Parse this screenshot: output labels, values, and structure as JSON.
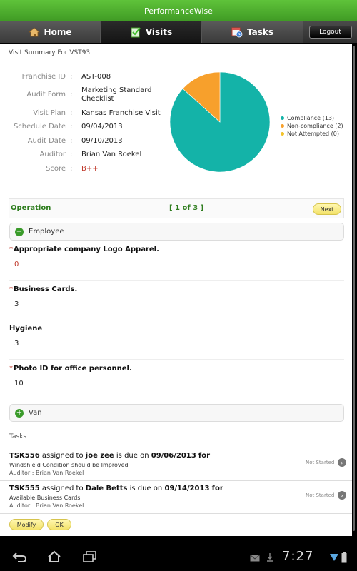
{
  "app": {
    "title": "PerformanceWise"
  },
  "nav": {
    "tabs": [
      {
        "label": "Home",
        "icon": "home-icon"
      },
      {
        "label": "Visits",
        "icon": "checklist-icon"
      },
      {
        "label": "Tasks",
        "icon": "calendar-clock-icon"
      }
    ],
    "active_tab": "Visits",
    "logout_label": "Logout"
  },
  "summary": {
    "title": "Visit Summary For VST93",
    "fields": [
      {
        "label": "Franchise ID",
        "value": "AST-008"
      },
      {
        "label": "Audit Form",
        "value": "Marketing Standard Checklist"
      },
      {
        "label": "Visit Plan",
        "value": "Kansas Franchise Visit"
      },
      {
        "label": "Schedule Date",
        "value": "09/04/2013"
      },
      {
        "label": "Audit Date",
        "value": "09/10/2013"
      },
      {
        "label": "Auditor",
        "value": "Brian Van Roekel"
      },
      {
        "label": "Score",
        "value": "B++"
      }
    ]
  },
  "chart_data": {
    "type": "pie",
    "categories": [
      "Compliance",
      "Non-compliance",
      "Not Attempted"
    ],
    "values": [
      13,
      2,
      0
    ],
    "legend": [
      "Compliance (13)",
      "Non-compliance (2)",
      "Not Attempted (0)"
    ],
    "colors": [
      "#14b3a8",
      "#f7a02c",
      "#f3c32b"
    ],
    "legend_position": "right"
  },
  "operation": {
    "title": "Operation",
    "page": "[ 1 of 3 ]",
    "next_label": "Next"
  },
  "sections": {
    "employee": "Employee",
    "van": "Van"
  },
  "questions": [
    {
      "text": "Appropriate company Logo Apparel.",
      "required": true,
      "answer": "0"
    },
    {
      "text": "Business Cards.",
      "required": true,
      "answer": "3"
    },
    {
      "text": "Hygiene",
      "required": false,
      "answer": "3"
    },
    {
      "text": "Photo ID for office personnel.",
      "required": true,
      "answer": "10"
    }
  ],
  "tasks": {
    "label": "Tasks",
    "items": [
      {
        "id": "TSK556",
        "assigned_text": "assigned to",
        "assignee": "joe zee",
        "due_text": "is due on",
        "due": "09/06/2013",
        "for_text": "for",
        "description": "Windshield Condition should be Improved",
        "auditor": "Auditor : Brian Van Roekel",
        "status": "Not Started"
      },
      {
        "id": "TSK555",
        "assigned_text": "assigned to",
        "assignee": "Dale Betts",
        "due_text": "is due on",
        "due": "09/14/2013",
        "for_text": "for",
        "description": "Available Business Cards",
        "auditor": "Auditor : Brian Van Roekel",
        "status": "Not Started"
      }
    ]
  },
  "footer": {
    "modify_label": "Modify",
    "ok_label": "OK"
  },
  "system": {
    "clock": "7:27"
  },
  "colors": {
    "brand_green": "#4caf2f",
    "accent_yellow": "#f3e26a",
    "score_red": "#c0392b"
  }
}
